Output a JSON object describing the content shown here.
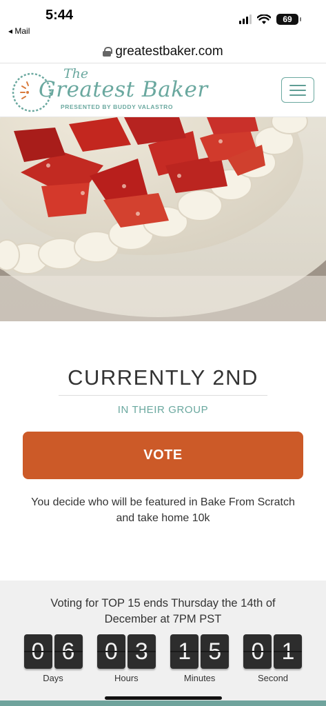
{
  "status_bar": {
    "time": "5:44",
    "back_label": "◂ Mail",
    "battery": "69"
  },
  "browser": {
    "url": "greatestbaker.com"
  },
  "header": {
    "logo_the": "The",
    "logo_title": "Greatest Baker",
    "logo_subtitle": "PRESENTED BY BUDDY VALASTRO",
    "menu_icon": "hamburger-icon"
  },
  "hero": {
    "image": "strawberry-cream-cake"
  },
  "ranking": {
    "title": "CURRENTLY 2ND",
    "subtitle": "IN THEIR GROUP",
    "vote_label": "VOTE",
    "description": "You decide who will be featured in Bake From Scratch and take home 10k"
  },
  "countdown": {
    "text": "Voting for TOP 15 ends Thursday the 14th of December at 7PM PST",
    "units": [
      {
        "label": "Days",
        "d1": "0",
        "d2": "6"
      },
      {
        "label": "Hours",
        "d1": "0",
        "d2": "3"
      },
      {
        "label": "Minutes",
        "d1": "1",
        "d2": "5"
      },
      {
        "label": "Second",
        "d1": "0",
        "d2": "1"
      }
    ]
  },
  "colors": {
    "accent": "#6aa89f",
    "vote": "#cc5a28"
  }
}
